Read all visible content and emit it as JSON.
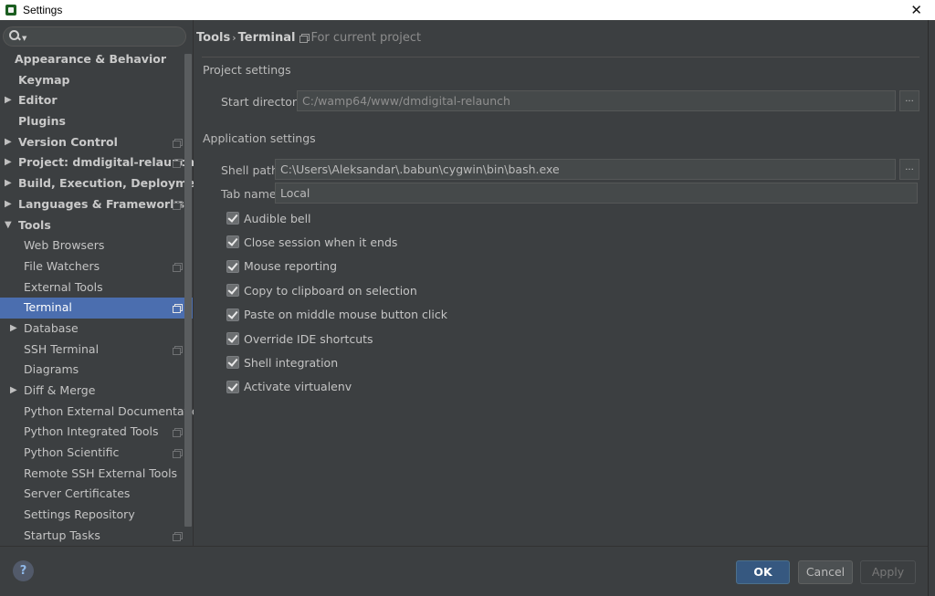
{
  "window": {
    "title": "Settings",
    "close": "✕"
  },
  "search": {
    "placeholder": ""
  },
  "sidebar": {
    "items": [
      {
        "label": "Appearance & Behavior",
        "bold": true,
        "level": 0,
        "arrow": "",
        "project": false
      },
      {
        "label": "Keymap",
        "bold": true,
        "level": 0,
        "arrow": "",
        "project": false
      },
      {
        "label": "Editor",
        "bold": true,
        "level": 0,
        "arrow": "▶",
        "project": false
      },
      {
        "label": "Plugins",
        "bold": true,
        "level": 0,
        "arrow": "",
        "project": false
      },
      {
        "label": "Version Control",
        "bold": true,
        "level": 0,
        "arrow": "▶",
        "project": true
      },
      {
        "label": "Project: dmdigital-relaunch",
        "bold": true,
        "level": 0,
        "arrow": "▶",
        "project": true
      },
      {
        "label": "Build, Execution, Deployment",
        "bold": true,
        "level": 0,
        "arrow": "▶",
        "project": false
      },
      {
        "label": "Languages & Frameworks",
        "bold": true,
        "level": 0,
        "arrow": "▶",
        "project": true
      },
      {
        "label": "Tools",
        "bold": true,
        "level": 0,
        "arrow": "▼",
        "project": false
      },
      {
        "label": "Web Browsers",
        "bold": false,
        "level": 1,
        "arrow": "",
        "project": false
      },
      {
        "label": "File Watchers",
        "bold": false,
        "level": 1,
        "arrow": "",
        "project": true
      },
      {
        "label": "External Tools",
        "bold": false,
        "level": 1,
        "arrow": "",
        "project": false
      },
      {
        "label": "Terminal",
        "bold": false,
        "level": 1,
        "arrow": "",
        "project": true,
        "selected": true
      },
      {
        "label": "Database",
        "bold": false,
        "level": 1,
        "arrow": "▶",
        "project": false
      },
      {
        "label": "SSH Terminal",
        "bold": false,
        "level": 1,
        "arrow": "",
        "project": true
      },
      {
        "label": "Diagrams",
        "bold": false,
        "level": 1,
        "arrow": "",
        "project": false
      },
      {
        "label": "Diff & Merge",
        "bold": false,
        "level": 1,
        "arrow": "▶",
        "project": false
      },
      {
        "label": "Python External Documentation",
        "bold": false,
        "level": 1,
        "arrow": "",
        "project": false
      },
      {
        "label": "Python Integrated Tools",
        "bold": false,
        "level": 1,
        "arrow": "",
        "project": true
      },
      {
        "label": "Python Scientific",
        "bold": false,
        "level": 1,
        "arrow": "",
        "project": true
      },
      {
        "label": "Remote SSH External Tools",
        "bold": false,
        "level": 1,
        "arrow": "",
        "project": false
      },
      {
        "label": "Server Certificates",
        "bold": false,
        "level": 1,
        "arrow": "",
        "project": false
      },
      {
        "label": "Settings Repository",
        "bold": false,
        "level": 1,
        "arrow": "",
        "project": false
      },
      {
        "label": "Startup Tasks",
        "bold": false,
        "level": 1,
        "arrow": "",
        "project": true
      }
    ]
  },
  "breadcrumb": {
    "parent": "Tools",
    "separator": "›",
    "current": "Terminal",
    "scope": "For current project"
  },
  "project_settings": {
    "title": "Project settings",
    "start_directory_label": "Start directory",
    "start_directory_value": "C:/wamp64/www/dmdigital-relaunch",
    "browse": "..."
  },
  "application_settings": {
    "title": "Application settings",
    "shell_path_label": "Shell path",
    "shell_path_value": "C:\\Users\\Aleksandar\\.babun\\cygwin\\bin\\bash.exe",
    "browse": "...",
    "tab_name_label": "Tab name",
    "tab_name_value": "Local",
    "checkboxes": [
      {
        "label": "Audible bell",
        "checked": true
      },
      {
        "label": "Close session when it ends",
        "checked": true
      },
      {
        "label": "Mouse reporting",
        "checked": true
      },
      {
        "label": "Copy to clipboard on selection",
        "checked": true
      },
      {
        "label": "Paste on middle mouse button click",
        "checked": true
      },
      {
        "label": "Override IDE shortcuts",
        "checked": true
      },
      {
        "label": "Shell integration",
        "checked": true
      },
      {
        "label": "Activate virtualenv",
        "checked": true
      }
    ]
  },
  "footer": {
    "help": "?",
    "ok": "OK",
    "cancel": "Cancel",
    "apply": "Apply"
  }
}
